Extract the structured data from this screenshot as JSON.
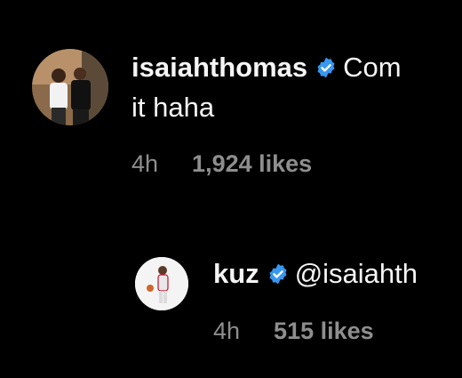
{
  "comments": [
    {
      "username": "isaiahthomas",
      "text_line1": "Com",
      "text_line2": "it haha",
      "time": "4h",
      "likes": "1,924 likes",
      "avatar_icon": "user-photo-icon",
      "verified_icon": "verified-badge-icon"
    },
    {
      "username": "kuz",
      "text_line1": "@isaiahth",
      "time": "4h",
      "likes": "515 likes",
      "avatar_icon": "user-photo-icon",
      "verified_icon": "verified-badge-icon"
    }
  ],
  "colors": {
    "background": "#000000",
    "text": "#f5f5f5",
    "meta": "#8e8e8e",
    "verified": "#3897f0"
  }
}
